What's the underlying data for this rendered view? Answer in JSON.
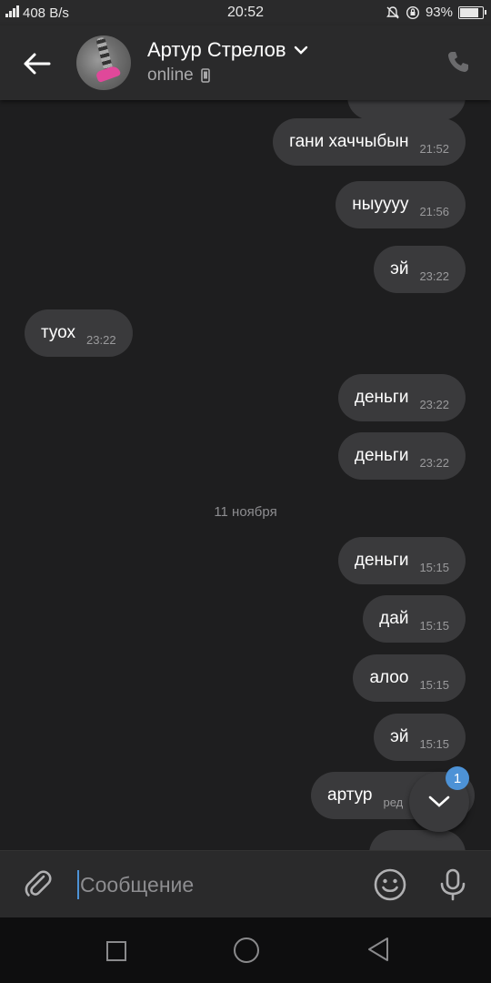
{
  "status_bar": {
    "speed": "408 B/s",
    "time": "20:52",
    "battery": "93%",
    "battery_level": 0.93
  },
  "header": {
    "contact_name": "Артур Стрелов",
    "status": "online",
    "icons": {
      "back": "arrow-left-icon",
      "dropdown": "chevron-down-icon",
      "device": "phone-device-icon",
      "call": "phone-call-icon"
    }
  },
  "messages": [
    {
      "text": "гани хаччыбын",
      "time": "21:52",
      "side": "out"
    },
    {
      "text": "ныуууу",
      "time": "21:56",
      "side": "out"
    },
    {
      "text": "эй",
      "time": "23:22",
      "side": "out"
    },
    {
      "text": "туох",
      "time": "23:22",
      "side": "in"
    },
    {
      "text": "деньги",
      "time": "23:22",
      "side": "out"
    },
    {
      "text": "деньги",
      "time": "23:22",
      "side": "out"
    },
    {
      "text": "деньги",
      "time": "15:15",
      "side": "out"
    },
    {
      "text": "дай",
      "time": "15:15",
      "side": "out"
    },
    {
      "text": "алоо",
      "time": "15:15",
      "side": "out"
    },
    {
      "text": "эй",
      "time": "15:15",
      "side": "out"
    },
    {
      "text": "артур",
      "time": "ред",
      "side": "out"
    }
  ],
  "date_separator": "11 ноября",
  "scroll_down": {
    "unread_count": "1"
  },
  "composer": {
    "placeholder": "Сообщение",
    "icons": {
      "attach": "paperclip-icon",
      "emoji": "smile-icon",
      "voice": "microphone-icon"
    }
  },
  "colors": {
    "background": "#1e1e1f",
    "bubble": "#3a3a3c",
    "accent": "#4d92d6",
    "bar": "#2a2a2b"
  }
}
